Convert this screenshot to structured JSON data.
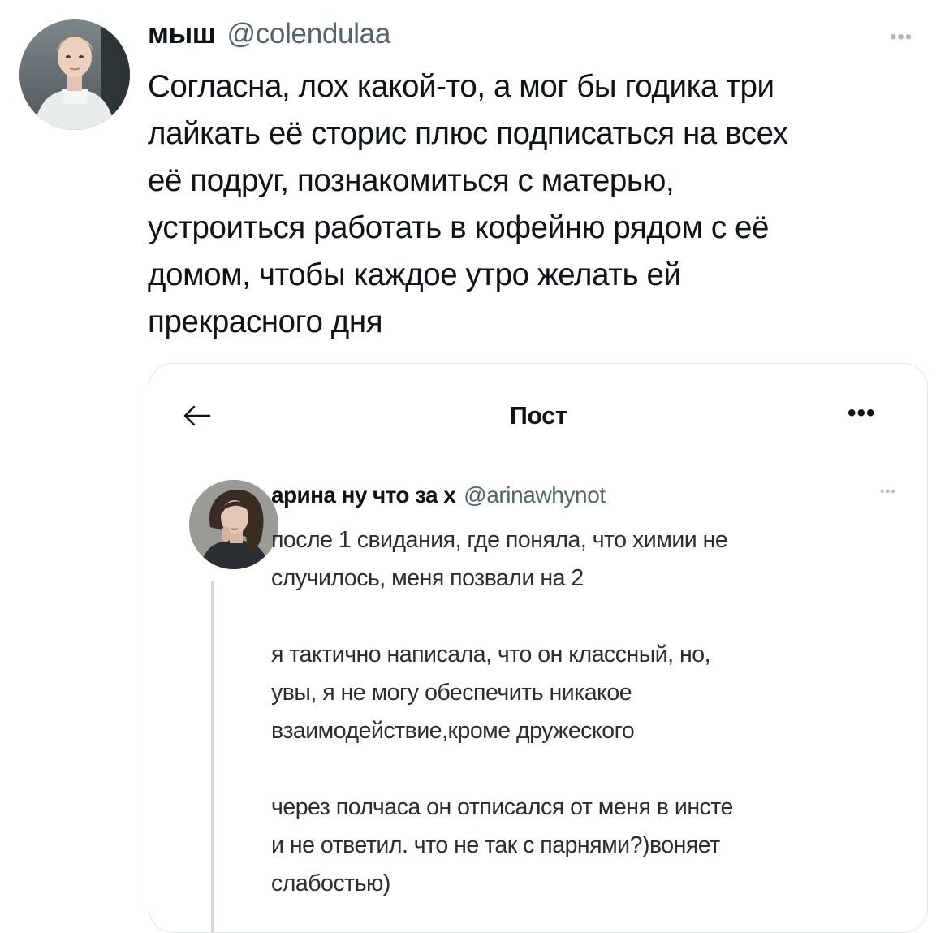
{
  "tweet": {
    "author": {
      "display_name": "мыш",
      "handle": "@colendulaa"
    },
    "more_icon": "more-horizontal-icon",
    "text_lines": [
      "Согласна, лох какой-то, а мог бы годика три",
      "лайкать её сторис плюс подписаться на всех",
      "её подруг, познакомиться с матерью,",
      "устроиться работать в кофейню рядом с её",
      "домом, чтобы каждое утро желать ей",
      "прекрасного дня"
    ]
  },
  "quoted_screenshot": {
    "topbar": {
      "back_icon": "arrow-left-icon",
      "title": "Пост",
      "more_icon": "more-horizontal-icon"
    },
    "post": {
      "author": {
        "display_name": "арина ну что за х",
        "handle": "@arinawhynot"
      },
      "paragraphs": [
        [
          "после 1 свидания, где поняла, что химии не",
          "случилось, меня позвали на 2"
        ],
        [
          "я тактично написала, что он классный, но,",
          "увы, я не могу обеспечить никакое",
          "взаимодействие,кроме дружеского"
        ],
        [
          "через полчаса он отписался от меня в инсте",
          "и не ответил. что не так с парнями?)воняет",
          "слабостью)"
        ]
      ]
    }
  },
  "colors": {
    "text_primary": "#0f1419",
    "text_secondary": "#536471",
    "border": "#e3e6e8",
    "thread_line": "#cfd9de"
  }
}
